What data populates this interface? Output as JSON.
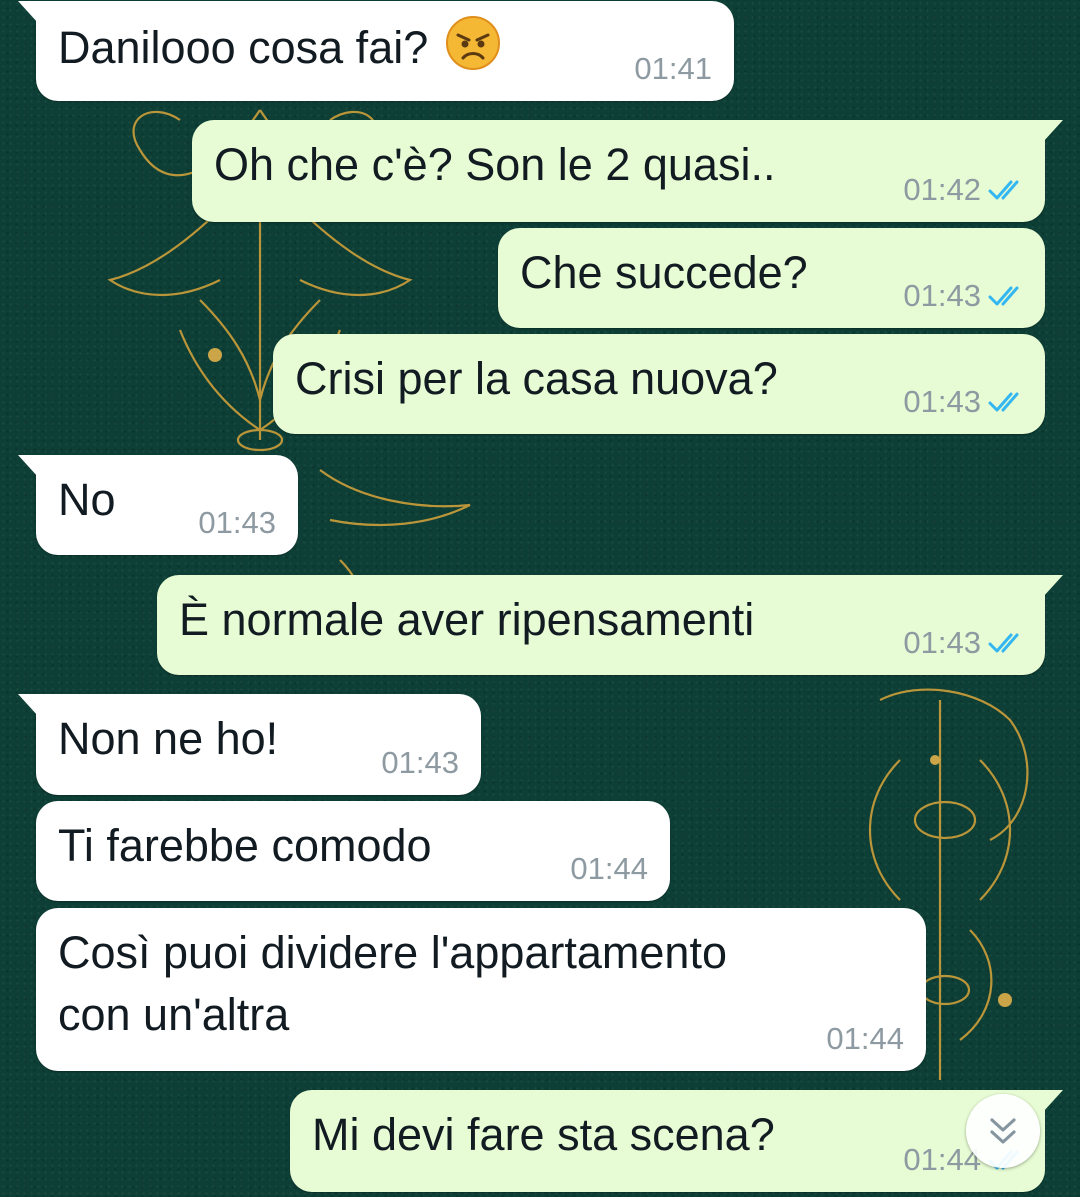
{
  "colors": {
    "wallpaper": "#0d3f36",
    "incoming_bubble": "#ffffff",
    "outgoing_bubble": "#e7fcd4",
    "timestamp": "#8e9aa1",
    "read_ticks": "#34b7f1"
  },
  "messages": [
    {
      "direction": "in",
      "text": "Danilooo cosa fai?",
      "emoji": "angry-face",
      "time": "01:41"
    },
    {
      "direction": "out",
      "text": "Oh che c'è? Son le 2 quasi..",
      "time": "01:42",
      "status": "read"
    },
    {
      "direction": "out",
      "text": "Che succede?",
      "time": "01:43",
      "status": "read"
    },
    {
      "direction": "out",
      "text": "Crisi per la casa nuova?",
      "time": "01:43",
      "status": "read"
    },
    {
      "direction": "in",
      "text": "No",
      "time": "01:43"
    },
    {
      "direction": "out",
      "text": "È normale aver ripensamenti",
      "time": "01:43",
      "status": "read"
    },
    {
      "direction": "in",
      "text": "Non ne ho!",
      "time": "01:43"
    },
    {
      "direction": "in",
      "text": "Ti farebbe comodo",
      "time": "01:44"
    },
    {
      "direction": "in",
      "text": "Così puoi dividere l'appartamento\ncon un'altra",
      "time": "01:44"
    },
    {
      "direction": "out",
      "text": "Mi devi fare sta scena?",
      "time": "01:44",
      "status": "read"
    }
  ],
  "scroll_button": {
    "icon": "double-chevron-down-icon"
  }
}
